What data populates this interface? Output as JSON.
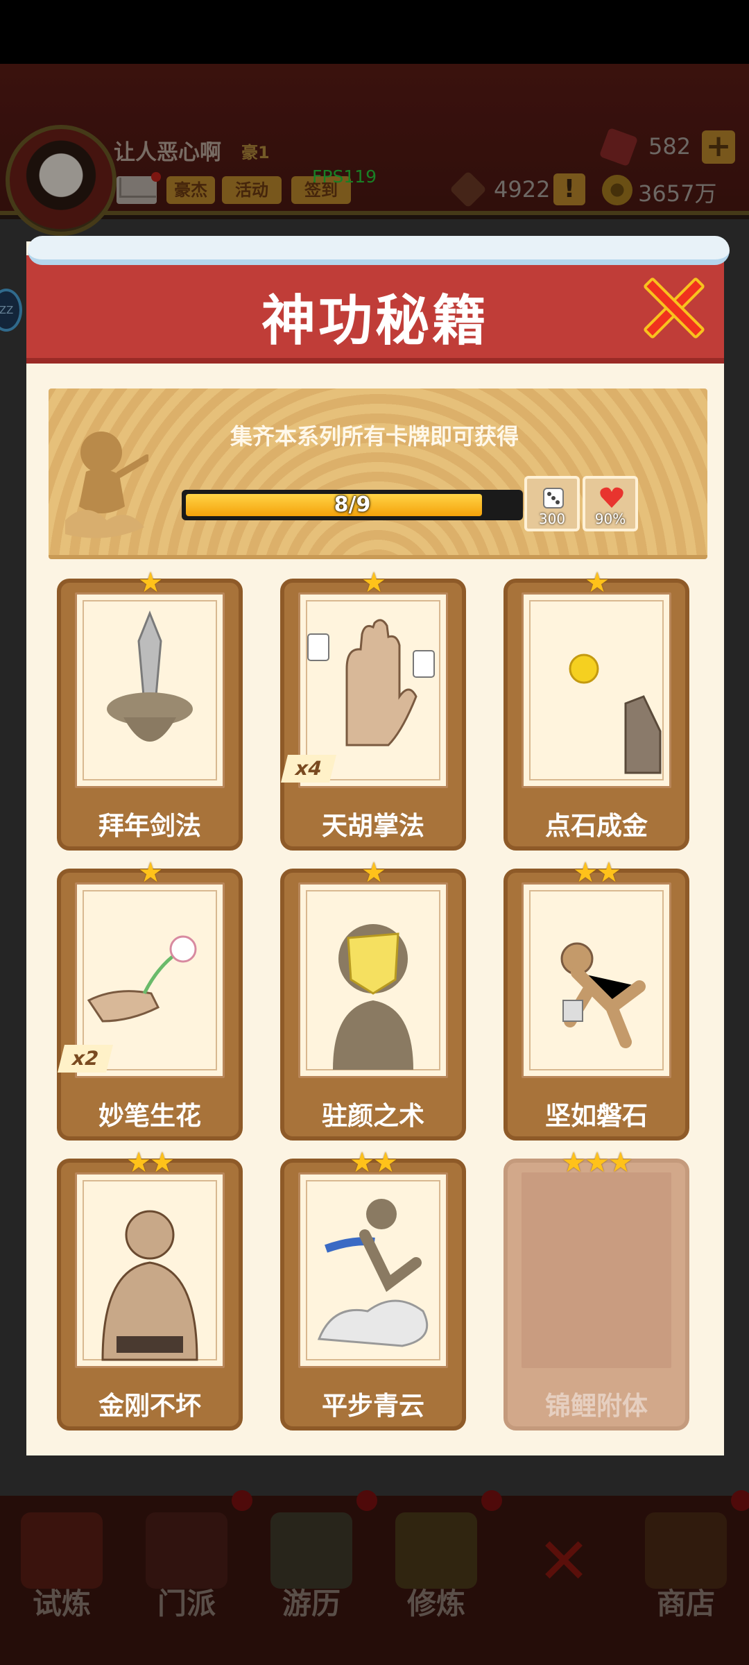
{
  "background": {
    "player_name": "让人恶心啊",
    "vip_tag": "豪1",
    "buttons": [
      "豪杰",
      "活动",
      "签到"
    ],
    "fps": "FPS119",
    "gems": "582",
    "tickets": "4922",
    "coins": "3657万",
    "side_badge": "ZZ",
    "nav": [
      "试炼",
      "门派",
      "游历",
      "修炼",
      "商店"
    ]
  },
  "modal": {
    "title": "神功秘籍",
    "banner_text": "集齐本系列所有卡牌即可获得",
    "progress_label": "8/9",
    "progress_fraction": 0.889,
    "rewards": [
      {
        "icon": "dice-icon",
        "value": "300"
      },
      {
        "icon": "heart-icon",
        "value": "90%"
      }
    ],
    "cards": [
      {
        "label": "拜年剑法",
        "stars": "★",
        "badge": "",
        "art": "sword-icon",
        "locked": false
      },
      {
        "label": "天胡掌法",
        "stars": "★",
        "badge": "x4",
        "art": "palm-icon",
        "locked": false
      },
      {
        "label": "点石成金",
        "stars": "★",
        "badge": "",
        "art": "gold-finger-icon",
        "locked": false
      },
      {
        "label": "妙笔生花",
        "stars": "★",
        "badge": "x2",
        "art": "flower-icon",
        "locked": false
      },
      {
        "label": "驻颜之术",
        "stars": "★",
        "badge": "",
        "art": "face-mask-icon",
        "locked": false
      },
      {
        "label": "坚如磐石",
        "stars": "★★",
        "badge": "",
        "art": "stone-man-icon",
        "locked": false
      },
      {
        "label": "金刚不坏",
        "stars": "★★",
        "badge": "",
        "art": "muscle-man-icon",
        "locked": false
      },
      {
        "label": "平步青云",
        "stars": "★★",
        "badge": "",
        "art": "cloud-rider-icon",
        "locked": false
      },
      {
        "label": "锦鲤附体",
        "stars": "★★★",
        "badge": "",
        "art": "",
        "locked": true
      }
    ]
  }
}
